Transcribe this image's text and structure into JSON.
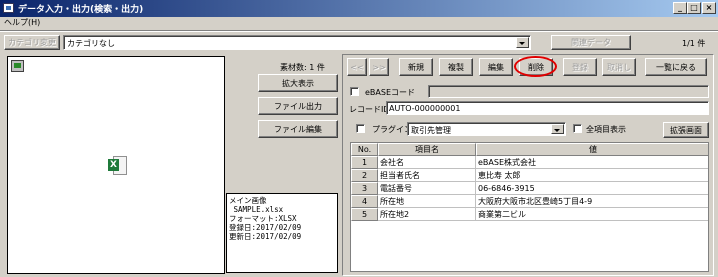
{
  "window": {
    "title": "データ入力・出力(検索・出力)",
    "controls": [
      "_",
      "□",
      "×"
    ]
  },
  "menubar": {
    "help": "ヘルプ(H)"
  },
  "toolbar": {
    "category_change": "カテゴリ変更",
    "category_value": "カテゴリなし",
    "related_data": "関連データ",
    "page_info": "1/1 件"
  },
  "left": {
    "material_count": "素材数: 1 件",
    "zoom_button": "拡大表示",
    "file_output_button": "ファイル出力",
    "file_edit_button": "ファイル編集",
    "file_icon_letter": "X",
    "meta_lines": [
      "メイン画像",
      " SAMPLE.xlsx",
      "フォーマット:XLSX",
      "登録日:2017/02/09",
      "更新日:2017/02/09"
    ]
  },
  "actions": {
    "first": "<<",
    "next": ">>",
    "new": "新規",
    "copy": "複製",
    "edit": "編集",
    "delete": "削除",
    "register": "登録",
    "cancel": "取消し",
    "back_to_list": "一覧に戻る",
    "delete_highlight_color": "#e00000"
  },
  "form": {
    "ebase_code_label": "eBASEコード",
    "record_id_label": "レコードID",
    "record_id_value": "AUTO-000000001",
    "plugin_label": "プラグイン",
    "plugin_value": "取引先管理",
    "all_items_label": "全項目表示",
    "expand_screen": "拡張画面"
  },
  "grid": {
    "headers": [
      "No.",
      "項目名",
      "値"
    ],
    "rows": [
      {
        "no": "1",
        "name": "会社名",
        "value": "eBASE株式会社"
      },
      {
        "no": "2",
        "name": "担当者氏名",
        "value": "恵比寿 太郎"
      },
      {
        "no": "3",
        "name": "電話番号",
        "value": "06-6846-3915"
      },
      {
        "no": "4",
        "name": "所在地",
        "value": "大阪府大阪市北区豊崎5丁目4-9"
      },
      {
        "no": "5",
        "name": "所在地2",
        "value": "商業第二ビル"
      }
    ]
  }
}
